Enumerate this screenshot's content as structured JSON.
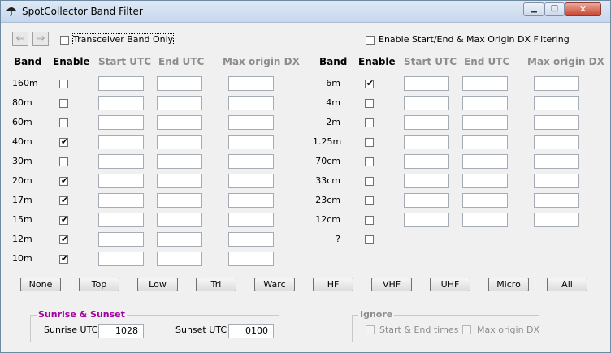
{
  "window": {
    "title": "SpotCollector Band Filter",
    "icons": {
      "app": "umbrella-icon",
      "minimize": "minimize-icon",
      "maximize": "maximize-icon",
      "close": "close-icon"
    }
  },
  "toolbar": {
    "back_icon": "arrow-left-icon",
    "forward_icon": "arrow-right-icon",
    "transceiver_band_only_label": "Transceiver Band Only",
    "transceiver_band_only_checked": false,
    "enable_filtering_label": "Enable Start/End & Max Origin DX Filtering",
    "enable_filtering_checked": false
  },
  "columns": {
    "band": "Band",
    "enable": "Enable",
    "start_utc": "Start UTC",
    "end_utc": "End UTC",
    "max_origin_dx": "Max origin DX"
  },
  "left_bands": [
    {
      "name": "160m",
      "enabled": false
    },
    {
      "name": "80m",
      "enabled": false
    },
    {
      "name": "60m",
      "enabled": false
    },
    {
      "name": "40m",
      "enabled": true
    },
    {
      "name": "30m",
      "enabled": false
    },
    {
      "name": "20m",
      "enabled": true
    },
    {
      "name": "17m",
      "enabled": true
    },
    {
      "name": "15m",
      "enabled": true
    },
    {
      "name": "12m",
      "enabled": true
    },
    {
      "name": "10m",
      "enabled": true
    }
  ],
  "right_bands": [
    {
      "name": "6m",
      "enabled": true,
      "has_fields": true
    },
    {
      "name": "4m",
      "enabled": false,
      "has_fields": true
    },
    {
      "name": "2m",
      "enabled": false,
      "has_fields": true
    },
    {
      "name": "1.25m",
      "enabled": false,
      "has_fields": true
    },
    {
      "name": "70cm",
      "enabled": false,
      "has_fields": true
    },
    {
      "name": "33cm",
      "enabled": false,
      "has_fields": true
    },
    {
      "name": "23cm",
      "enabled": false,
      "has_fields": true
    },
    {
      "name": "12cm",
      "enabled": false,
      "has_fields": true
    },
    {
      "name": "?",
      "enabled": false,
      "has_fields": false
    }
  ],
  "preset_buttons": [
    "None",
    "Top",
    "Low",
    "Tri",
    "Warc",
    "HF",
    "VHF",
    "UHF",
    "Micro",
    "All"
  ],
  "sunrise_sunset": {
    "title": "Sunrise & Sunset",
    "title_color": "#a000a0",
    "sunrise_label": "Sunrise UTC",
    "sunrise_value": "1028",
    "sunset_label": "Sunset UTC",
    "sunset_value": "0100"
  },
  "ignore": {
    "title": "Ignore",
    "start_end_label": "Start & End times",
    "max_origin_label": "Max origin DX"
  }
}
